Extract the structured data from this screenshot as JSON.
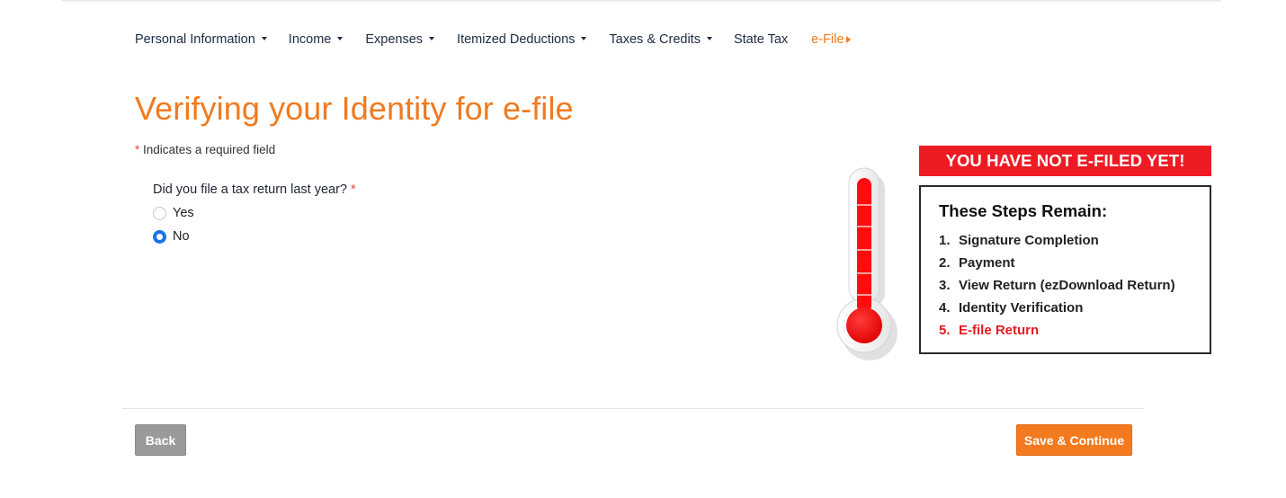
{
  "nav": {
    "items": [
      {
        "label": "Personal Information",
        "dropdown": true
      },
      {
        "label": "Income",
        "dropdown": true
      },
      {
        "label": "Expenses",
        "dropdown": true
      },
      {
        "label": "Itemized Deductions",
        "dropdown": true
      },
      {
        "label": "Taxes & Credits",
        "dropdown": true
      },
      {
        "label": "State Tax",
        "dropdown": false
      },
      {
        "label": "e-File",
        "dropdown": false,
        "active": true
      }
    ]
  },
  "page": {
    "title": "Verifying your Identity for e-file",
    "required_star": "*",
    "required_note": "Indicates a required field"
  },
  "question": {
    "label": "Did you file a tax return last year?",
    "required_star": "*",
    "options": [
      {
        "label": "Yes",
        "checked": false
      },
      {
        "label": "No",
        "checked": true
      }
    ]
  },
  "status_panel": {
    "banner": "YOU HAVE NOT E-FILED YET!",
    "steps_title": "These Steps Remain:",
    "steps": [
      {
        "num": "1.",
        "label": "Signature Completion"
      },
      {
        "num": "2.",
        "label": "Payment"
      },
      {
        "num": "3.",
        "label": "View Return (ezDownload Return)"
      },
      {
        "num": "4.",
        "label": "Identity Verification"
      },
      {
        "num": "5.",
        "label": "E-file Return",
        "current": true
      }
    ]
  },
  "buttons": {
    "back": "Back",
    "save_continue": "Save & Continue"
  },
  "colors": {
    "accent_orange": "#f07a20",
    "alert_red": "#ee1b24",
    "radio_blue": "#1a73e8"
  },
  "icons": {
    "thermometer": "thermometer-icon"
  }
}
